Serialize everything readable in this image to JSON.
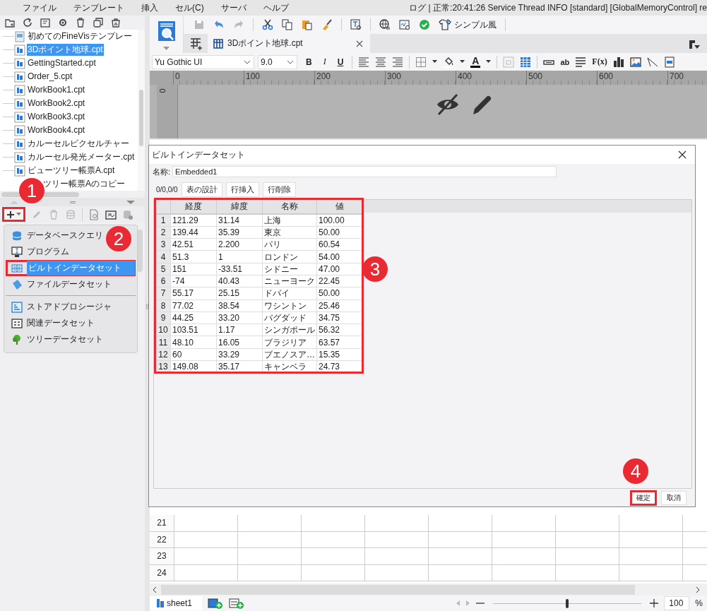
{
  "menu": [
    "ファイル",
    "テンプレート",
    "挿入",
    "セル(C)",
    "サーバ",
    "ヘルプ"
  ],
  "log_text": "ログ | 正常:20:41:26 Service Thread INFO [standard] [GlobalMemoryControl] re",
  "file_tree": [
    {
      "label": "初めてのFineVisテンプレー",
      "selected": false,
      "kind": "visual"
    },
    {
      "label": "3Dポイント地球.cpt",
      "selected": true,
      "kind": "report"
    },
    {
      "label": "GettingStarted.cpt",
      "selected": false,
      "kind": "report"
    },
    {
      "label": "Order_5.cpt",
      "selected": false,
      "kind": "report"
    },
    {
      "label": "WorkBook1.cpt",
      "selected": false,
      "kind": "report"
    },
    {
      "label": "WorkBook2.cpt",
      "selected": false,
      "kind": "report"
    },
    {
      "label": "WorkBook3.cpt",
      "selected": false,
      "kind": "report"
    },
    {
      "label": "WorkBook4.cpt",
      "selected": false,
      "kind": "report"
    },
    {
      "label": "カルーセルピクセルチャー",
      "selected": false,
      "kind": "report"
    },
    {
      "label": "カルーセル発光メーター.cpt",
      "selected": false,
      "kind": "report"
    },
    {
      "label": "ビューツリー帳票A.cpt",
      "selected": false,
      "kind": "report"
    },
    {
      "label": "ツリー帳票Aのコピー",
      "selected": false,
      "kind": "covered"
    }
  ],
  "dataset_toolbar": {
    "add_highlighted": true
  },
  "dataset_menu": {
    "sections": [
      {
        "items": [
          {
            "label": "データベースクエリ",
            "selected": false,
            "highlighted": false,
            "kind": "database"
          },
          {
            "label": "プログラム",
            "selected": false,
            "highlighted": false,
            "kind": "program"
          },
          {
            "label": "ビルトインデータセット",
            "selected": true,
            "highlighted": true,
            "kind": "builtin"
          },
          {
            "label": "ファイルデータセット",
            "selected": false,
            "highlighted": false,
            "kind": "file"
          }
        ]
      },
      {
        "items": [
          {
            "label": "ストアドプロシージャ",
            "selected": false,
            "highlighted": false,
            "kind": "procedure"
          },
          {
            "label": "関連データセット",
            "selected": false,
            "highlighted": false,
            "kind": "relation"
          },
          {
            "label": "ツリーデータセット",
            "selected": false,
            "highlighted": false,
            "kind": "tree"
          }
        ]
      }
    ]
  },
  "toolbar": {
    "style_button": "シンプル風"
  },
  "tab": {
    "label": "3Dポイント地球.cpt"
  },
  "format_toolbar": {
    "font": "Yu Gothic UI",
    "size": "9.0",
    "style_buttons": [
      "B",
      "I",
      "U"
    ],
    "font_color_glyph": "A",
    "text_glyphs": [
      "ab",
      "F(x)"
    ]
  },
  "ruler": {
    "labels": [
      "0",
      "100",
      "200",
      "300",
      "400",
      "500",
      "600",
      "700"
    ],
    "vertical_label": "0"
  },
  "sheet": {
    "rows": [
      "21",
      "22",
      "23",
      "24"
    ],
    "tab": "sheet1",
    "zoom": "100",
    "zoom_unit": "%",
    "zoom_slider": {
      "level": 0.5
    }
  },
  "dialog": {
    "title": "ビルトインデータセット",
    "name_label": "名称:",
    "name_value": "Embedded1",
    "counter": "0/0,0/0",
    "buttons": [
      "表の設計",
      "行挿入",
      "行削除"
    ],
    "table": {
      "highlighted": true,
      "columns": [
        "経度",
        "緯度",
        "名称",
        "値"
      ],
      "rows": [
        {
          "num": "1",
          "cells": [
            "121.29",
            "31.14",
            "上海",
            "100.00"
          ]
        },
        {
          "num": "2",
          "cells": [
            "139.44",
            "35.39",
            "東京",
            "50.00"
          ]
        },
        {
          "num": "3",
          "cells": [
            "42.51",
            "2.200",
            "パリ",
            "60.54"
          ]
        },
        {
          "num": "4",
          "cells": [
            "51.3",
            "1",
            "ロンドン",
            "54.00"
          ]
        },
        {
          "num": "5",
          "cells": [
            "151",
            "-33.51",
            "シドニー",
            "47.00"
          ]
        },
        {
          "num": "6",
          "cells": [
            "-74",
            "40.43",
            "ニューヨーク",
            "22.45"
          ]
        },
        {
          "num": "7",
          "cells": [
            "55.17",
            "25.15",
            "ドバイ",
            "50.00"
          ]
        },
        {
          "num": "8",
          "cells": [
            "77.02",
            "38.54",
            "ワシントン",
            "25.46"
          ]
        },
        {
          "num": "9",
          "cells": [
            "44.25",
            "33.20",
            "バグダッド",
            "34.75"
          ]
        },
        {
          "num": "10",
          "cells": [
            "103.51",
            "1.17",
            "シンガポール",
            "56.32"
          ]
        },
        {
          "num": "11",
          "cells": [
            "48.10",
            "16.05",
            "ブラジリア",
            "63.57"
          ]
        },
        {
          "num": "12",
          "cells": [
            "60",
            "33.29",
            "ブエノスア…",
            "15.35"
          ]
        },
        {
          "num": "13",
          "cells": [
            "149.08",
            "35.17",
            "キャンベラ",
            "24.73"
          ]
        }
      ]
    },
    "ok": {
      "label": "確定",
      "highlighted": true
    },
    "cancel": {
      "label": "取消",
      "highlighted": false
    }
  },
  "callouts": [
    "1",
    "2",
    "3",
    "4"
  ]
}
